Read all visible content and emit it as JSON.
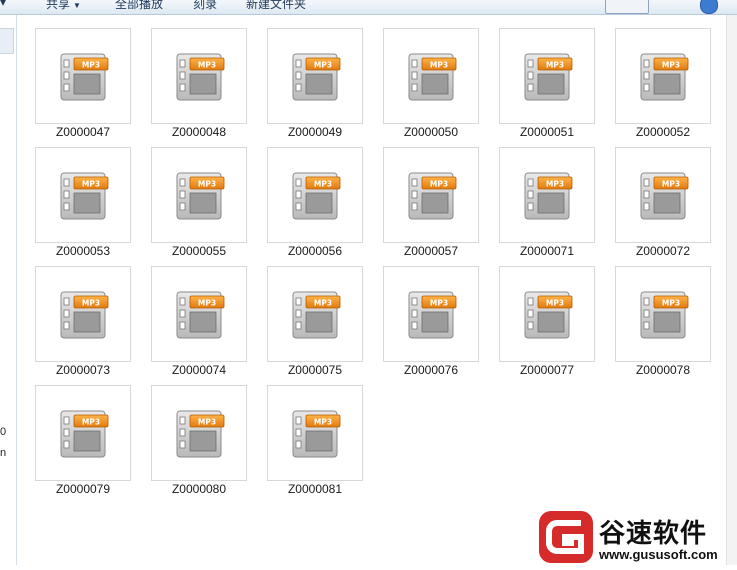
{
  "toolbar": {
    "share": "共享",
    "play_all": "全部播放",
    "burn": "刻录",
    "new_folder": "新建文件夹"
  },
  "sidebar": {
    "frag1": "0",
    "frag2": "n"
  },
  "files": [
    "Z0000047",
    "Z0000048",
    "Z0000049",
    "Z0000050",
    "Z0000051",
    "Z0000052",
    "Z0000053",
    "Z0000055",
    "Z0000056",
    "Z0000057",
    "Z0000071",
    "Z0000072",
    "Z0000073",
    "Z0000074",
    "Z0000075",
    "Z0000076",
    "Z0000077",
    "Z0000078",
    "Z0000079",
    "Z0000080",
    "Z0000081"
  ],
  "icon": {
    "badge": "MP3",
    "name": "mp3-file-icon"
  },
  "colors": {
    "accent_orange": "#f08a1c",
    "logo_red": "#d62b2b"
  },
  "watermark": {
    "brand": "谷速软件",
    "url": "www.gususoft.com"
  }
}
